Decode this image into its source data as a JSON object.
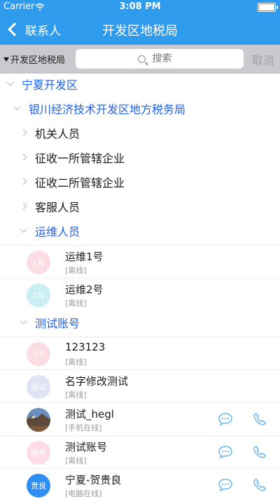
{
  "status_bar": {
    "carrier": "Carrier",
    "time": "3:08 PM"
  },
  "nav": {
    "back_label": "联系人",
    "title": "开发区地税局"
  },
  "search": {
    "scope_label": "开发区地税局",
    "placeholder": "搜索",
    "cancel_label": "取消"
  },
  "tree": {
    "root": "宁夏开发区",
    "org": "银川经济技术开发区地方税务局",
    "groups": [
      "机关人员",
      "征收一所管辖企业",
      "征收二所管辖企业",
      "客服人员"
    ],
    "ops_group": "运维人员",
    "test_group": "测试账号"
  },
  "ops_members": [
    {
      "avatar_text": "1号",
      "name": "运维1号",
      "status": "[离线]"
    },
    {
      "avatar_text": "2号",
      "name": "运维2号",
      "status": "[离线]"
    }
  ],
  "test_members": [
    {
      "avatar_text": "23",
      "name": "123123",
      "status": "[离线]"
    },
    {
      "avatar_text": "测试",
      "name": "名字修改测试",
      "status": "[离线]"
    },
    {
      "avatar_text": "",
      "name": "测试_hegl",
      "status": "[手机在线]"
    },
    {
      "avatar_text": "账号",
      "name": "测试账号",
      "status": "[离线]"
    },
    {
      "avatar_text": "贵良",
      "name": "宁夏-贺贵良",
      "status": "[电脑在线]"
    }
  ],
  "colors": {
    "accent": "#2f9bec",
    "group_blue": "#1f5fea",
    "action_icon": "#6ab6f0"
  },
  "icons": {
    "message": "message-icon",
    "phone": "phone-icon",
    "search": "search-icon",
    "back": "chevron-left-icon"
  }
}
